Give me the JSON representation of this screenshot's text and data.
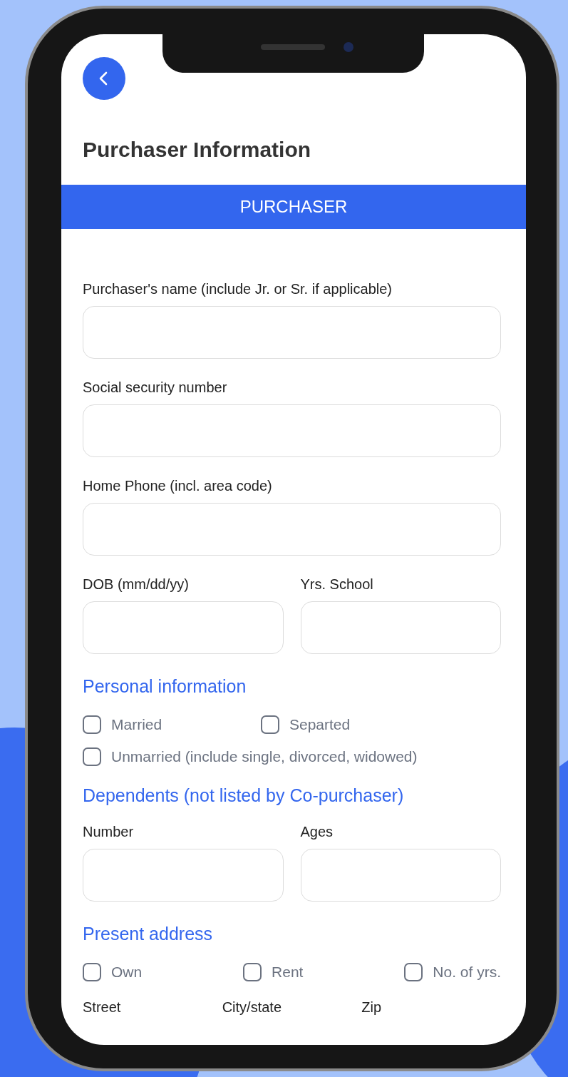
{
  "screen_title": "Purchaser Information",
  "section_banner": "PURCHASER",
  "form": [
    {
      "kind": "field",
      "fields": [
        {
          "label": "Purchaser's name (include Jr. or Sr. if applicable)"
        }
      ]
    },
    {
      "kind": "field",
      "fields": [
        {
          "label": "Social security number"
        }
      ]
    },
    {
      "kind": "field",
      "fields": [
        {
          "label": "Home Phone (incl. area code)"
        }
      ]
    },
    {
      "kind": "field",
      "fields": [
        {
          "label": "DOB (mm/dd/yy)"
        },
        {
          "label": "Yrs. School"
        }
      ]
    },
    {
      "kind": "heading",
      "text": "Personal information"
    },
    {
      "kind": "checks",
      "rows": [
        [
          {
            "label": "Married",
            "checked": false
          },
          {
            "label": "Separted",
            "checked": false
          }
        ],
        [
          {
            "label": "Unmarried (include single, divorced, widowed)",
            "checked": false
          }
        ]
      ]
    },
    {
      "kind": "heading",
      "text": "Dependents (not listed by Co-purchaser)"
    },
    {
      "kind": "field",
      "fields": [
        {
          "label": "Number"
        },
        {
          "label": "Ages"
        }
      ]
    },
    {
      "kind": "heading",
      "text": "Present address"
    },
    {
      "kind": "checks",
      "rows": [
        [
          {
            "label": "Own",
            "checked": false
          },
          {
            "label": "Rent",
            "checked": false
          },
          {
            "label": "No. of yrs.",
            "checked": false
          }
        ]
      ]
    },
    {
      "kind": "labels",
      "labels": [
        "Street",
        "City/state",
        "Zip"
      ]
    }
  ]
}
